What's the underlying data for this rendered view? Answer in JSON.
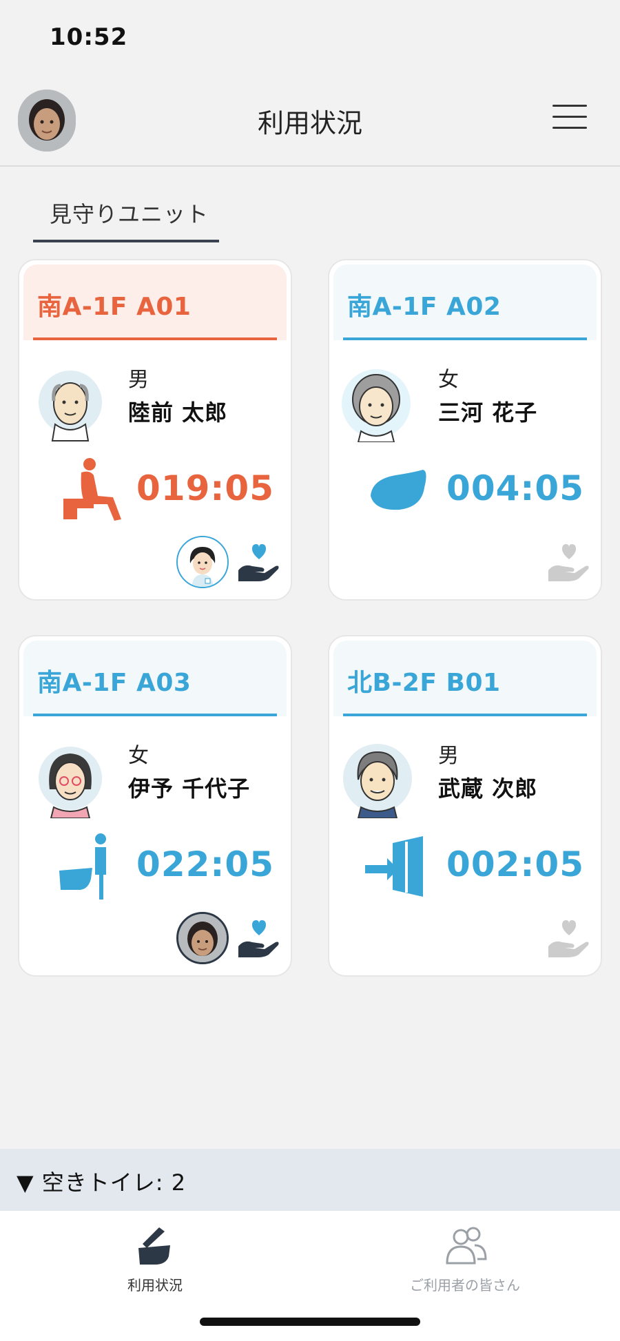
{
  "status_bar": {
    "time": "10:52"
  },
  "header": {
    "title": "利用状況",
    "avatar_icon": "user-avatar-icon",
    "menu_icon": "hamburger-menu-icon"
  },
  "tabs": {
    "unit_label": "見守りユニット"
  },
  "colors": {
    "alert": "#e8643f",
    "normal": "#3aa6d8",
    "care": "#2d3846",
    "care_inactive": "#cccccc"
  },
  "cards": [
    {
      "room": "南A-1F A01",
      "gender": "男",
      "name": "陸前 太郎",
      "timer": "019:05",
      "status_icon": "toilet-sitting-icon",
      "state": "alert",
      "staff": true,
      "care_active": true
    },
    {
      "room": "南A-1F A02",
      "gender": "女",
      "name": "三河 花子",
      "timer": "004:05",
      "status_icon": "stool-icon",
      "state": "normal",
      "staff": false,
      "care_active": false
    },
    {
      "room": "南A-1F A03",
      "gender": "女",
      "name": "伊予 千代子",
      "timer": "022:05",
      "status_icon": "toilet-standing-icon",
      "state": "normal",
      "staff": true,
      "care_active": true
    },
    {
      "room": "北B-2F B01",
      "gender": "男",
      "name": "武蔵 次郎",
      "timer": "002:05",
      "status_icon": "door-exit-icon",
      "state": "normal",
      "staff": false,
      "care_active": false
    }
  ],
  "vacancy": {
    "text": "▼ 空きトイレ: 2"
  },
  "bottom_nav": [
    {
      "label": "利用状況",
      "icon": "toilet-status-icon",
      "active": true
    },
    {
      "label": "ご利用者の皆さん",
      "icon": "users-icon",
      "active": false
    }
  ]
}
